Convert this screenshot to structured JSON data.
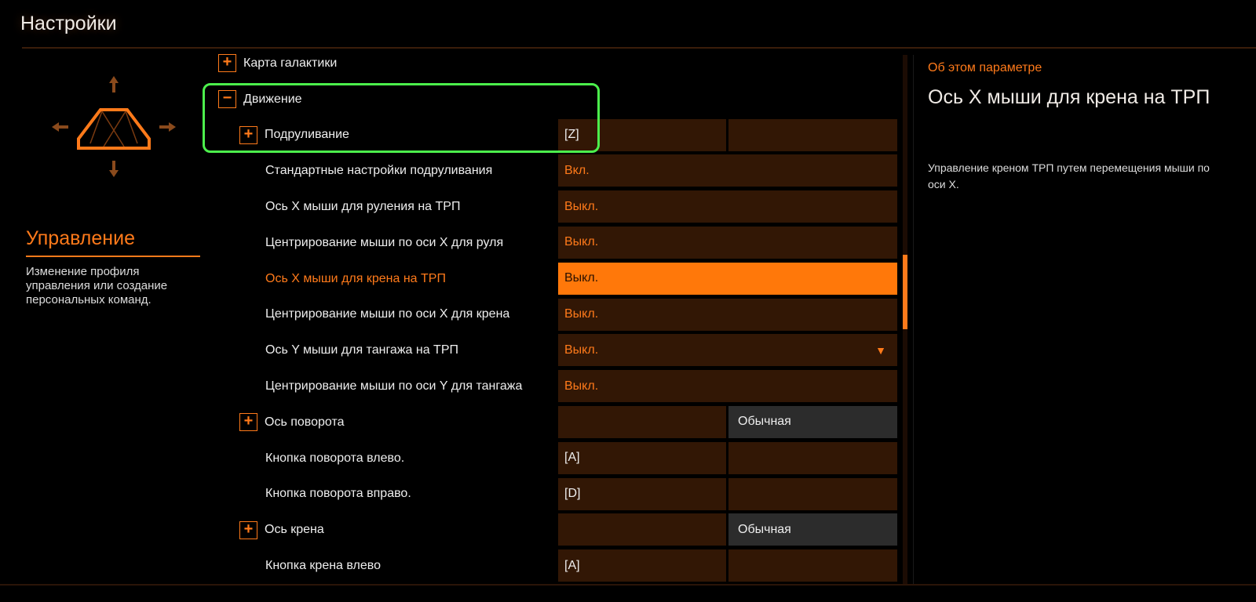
{
  "header": {
    "title": "Настройки"
  },
  "section": {
    "title": "Управление",
    "description": "Изменение профиля управления или создание персональных команд."
  },
  "rows": [
    {
      "label": "Карта галактики",
      "type": "group",
      "expanded": false,
      "indent": 0
    },
    {
      "label": "Движение",
      "type": "group",
      "expanded": true,
      "indent": 0
    },
    {
      "label": "Подруливание",
      "type": "group",
      "expanded": false,
      "indent": 1,
      "key": "[Z]",
      "alt": ""
    },
    {
      "label": "Стандартные настройки подруливания",
      "type": "toggle",
      "value": "Вкл."
    },
    {
      "label": "Ось X мыши для руления на ТРП",
      "type": "toggle",
      "value": "Выкл."
    },
    {
      "label": "Центрирование мыши по оси X для руля",
      "type": "toggle",
      "value": "Выкл."
    },
    {
      "label": "Ось X мыши для крена на ТРП",
      "type": "toggle",
      "value": "Выкл.",
      "selected": true
    },
    {
      "label": "Центрирование мыши по оси X для крена",
      "type": "toggle",
      "value": "Выкл."
    },
    {
      "label": "Ось Y мыши для тангажа на ТРП",
      "type": "toggle",
      "value": "Выкл.",
      "dropdown": true
    },
    {
      "label": "Центрирование мыши по оси Y для тангажа",
      "type": "toggle",
      "value": "Выкл."
    },
    {
      "label": "Ось поворота",
      "type": "group",
      "expanded": false,
      "indent": 1,
      "key": "",
      "alt": "Обычная"
    },
    {
      "label": "Кнопка поворота влево.",
      "type": "bind",
      "key": "[A]",
      "alt": ""
    },
    {
      "label": "Кнопка поворота вправо.",
      "type": "bind",
      "key": "[D]",
      "alt": ""
    },
    {
      "label": "Ось крена",
      "type": "group",
      "expanded": false,
      "indent": 1,
      "key": "",
      "alt": "Обычная"
    },
    {
      "label": "Кнопка крена влево",
      "type": "bind",
      "key": "[A]",
      "alt": ""
    }
  ],
  "info": {
    "heading": "Об этом параметре",
    "title": "Ось X мыши для крена на ТРП",
    "description": "Управление креном ТРП путем перемещения мыши по оси X."
  },
  "colors": {
    "accent": "#ff7a1a",
    "cell": "#321705",
    "highlight": "#4cf04c"
  },
  "scrollbar": {
    "position_fraction": 0.38
  }
}
